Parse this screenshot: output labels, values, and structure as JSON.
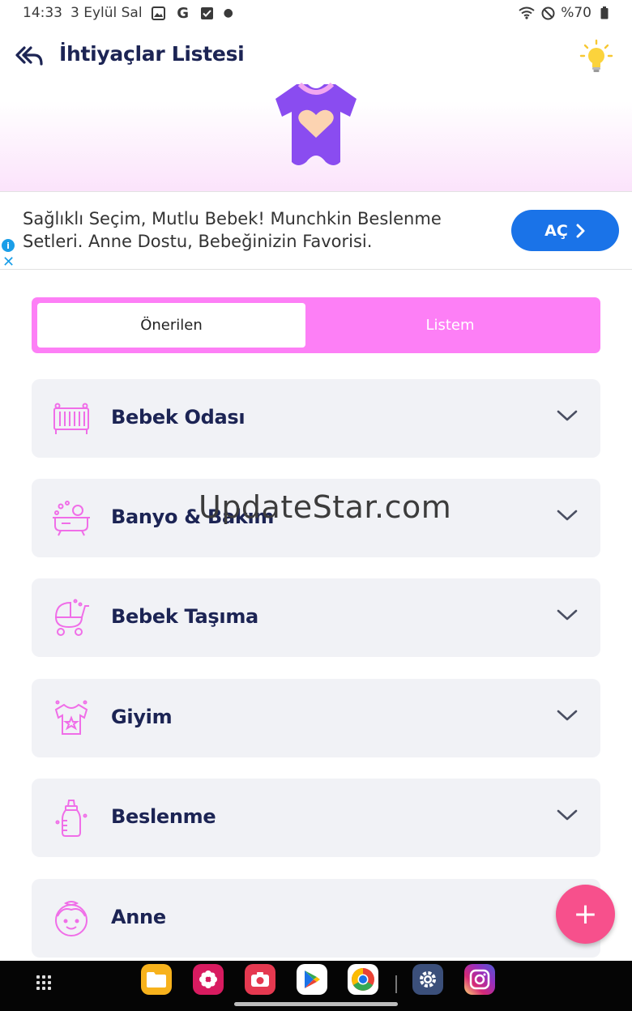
{
  "status_bar": {
    "time": "14:33",
    "date": "3 Eylül Sal",
    "battery": "%70"
  },
  "header": {
    "title": "İhtiyaçlar Listesi"
  },
  "ad": {
    "text": "Sağlıklı Seçim, Mutlu Bebek! Munchkin Beslenme Setleri. Anne Dostu, Bebeğinizin Favorisi.",
    "button_label": "AÇ"
  },
  "tabs": {
    "active": "Önerilen",
    "inactive": "Listem"
  },
  "categories": [
    {
      "label": "Bebek Odası",
      "icon": "crib-icon"
    },
    {
      "label": "Banyo & Bakım",
      "icon": "bathtub-icon"
    },
    {
      "label": "Bebek Taşıma",
      "icon": "stroller-icon"
    },
    {
      "label": "Giyim",
      "icon": "tshirt-icon"
    },
    {
      "label": "Beslenme",
      "icon": "bottle-icon"
    },
    {
      "label": "Anne",
      "icon": "mother-face-icon"
    }
  ],
  "watermark": "UpdateStar.com",
  "fab_label": "+",
  "colors": {
    "accent_pink": "#fd7ff6",
    "icon_pink": "#f06ee8",
    "fab": "#f7508c",
    "ad_button": "#1a73e8",
    "title": "#1c2454"
  }
}
